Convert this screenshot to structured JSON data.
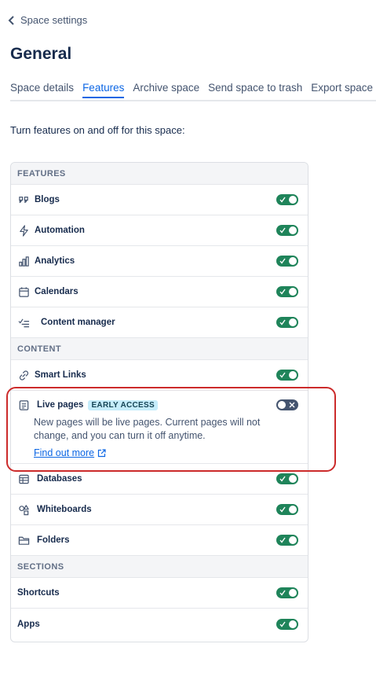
{
  "header": {
    "back_label": "Space settings",
    "title": "General"
  },
  "tabs": [
    {
      "label": "Space details"
    },
    {
      "label": "Features"
    },
    {
      "label": "Archive space"
    },
    {
      "label": "Send space to trash"
    },
    {
      "label": "Export space"
    }
  ],
  "intro": "Turn features on and off for this space:",
  "sections": {
    "features": "FEATURES",
    "content": "CONTENT",
    "sections": "SECTIONS"
  },
  "features": [
    {
      "label": "Blogs",
      "icon": "quote-icon",
      "enabled": true
    },
    {
      "label": "Automation",
      "icon": "lightning-icon",
      "enabled": true
    },
    {
      "label": "Analytics",
      "icon": "bar-chart-icon",
      "enabled": true
    },
    {
      "label": "Calendars",
      "icon": "calendar-icon",
      "enabled": true
    },
    {
      "label": "Content manager",
      "icon": "checklist-icon",
      "enabled": true
    }
  ],
  "content": {
    "smart_links": {
      "label": "Smart Links",
      "icon": "link-icon",
      "enabled": true
    },
    "live_pages": {
      "label": "Live pages",
      "badge": "EARLY ACCESS",
      "description": "New pages will be live pages. Current pages will not change, and you can turn it off anytime.",
      "link": "Find out more",
      "icon": "page-icon",
      "enabled": false
    },
    "databases": {
      "label": "Databases",
      "icon": "table-icon",
      "enabled": true
    },
    "whiteboards": {
      "label": "Whiteboards",
      "icon": "shapes-icon",
      "enabled": true
    },
    "folders": {
      "label": "Folders",
      "icon": "folder-icon",
      "enabled": true
    }
  },
  "section_items": [
    {
      "label": "Shortcuts",
      "enabled": true
    },
    {
      "label": "Apps",
      "enabled": true
    }
  ],
  "colors": {
    "toggle_on": "#1f845a",
    "toggle_off": "#44546f",
    "accent": "#0c66e4",
    "highlight": "#cc2b2b"
  }
}
